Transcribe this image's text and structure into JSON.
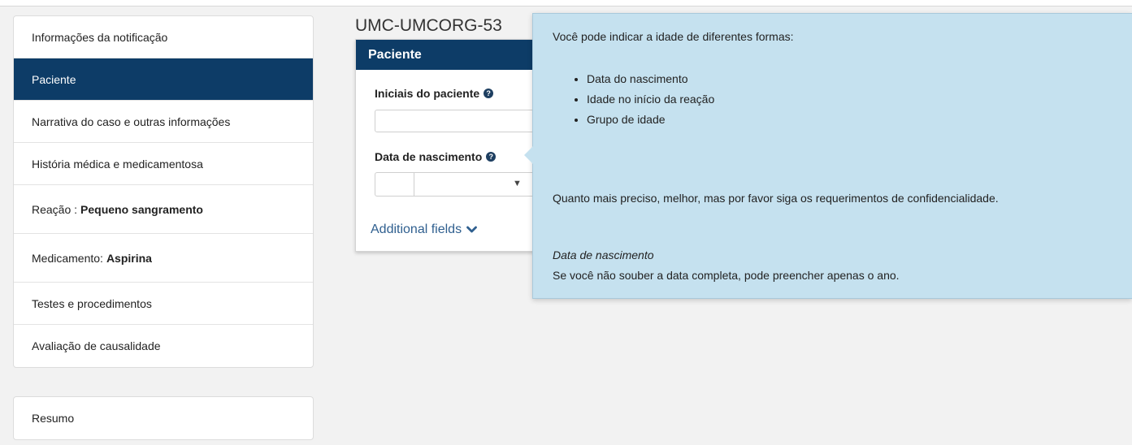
{
  "sidebar": {
    "items": [
      {
        "label": "Informações da notificação",
        "value": ""
      },
      {
        "label": "Paciente",
        "value": ""
      },
      {
        "label": "Narrativa do caso e outras informações",
        "value": ""
      },
      {
        "label": "História médica e medicamentosa",
        "value": ""
      },
      {
        "label": "Reação :",
        "value": "Pequeno sangramento"
      },
      {
        "label": "Medicamento:",
        "value": "Aspirina"
      },
      {
        "label": "Testes e procedimentos",
        "value": ""
      },
      {
        "label": "Avaliação de causalidade",
        "value": ""
      }
    ],
    "summary_label": "Resumo",
    "active_index": 1,
    "active_color": "#0d3c67"
  },
  "case_id": "UMC-UMCORG-53",
  "panel": {
    "title": "Paciente",
    "initials_label": "Iniciais do paciente",
    "initials_value": "",
    "birth_label": "Data de nascimento",
    "day_value": "",
    "month_value": "",
    "additional_fields": "Additional fields"
  },
  "tooltip": {
    "title": "Você pode indicar a idade de diferentes formas:",
    "options": [
      "Data do nascimento",
      "Idade no início da reação",
      "Grupo de idade"
    ],
    "note": "Quanto mais preciso, melhor, mas por favor siga os requerimentos de confidencialidade.",
    "sub_title": "Data de nascimento",
    "sub_text": "Se você não souber a data completa, pode preencher apenas o ano.",
    "background": "#c5e1ef"
  },
  "icons": {
    "help": "question-circle-icon",
    "expand": "chevron-down-icon",
    "select_arrow": "caret-down-icon"
  }
}
